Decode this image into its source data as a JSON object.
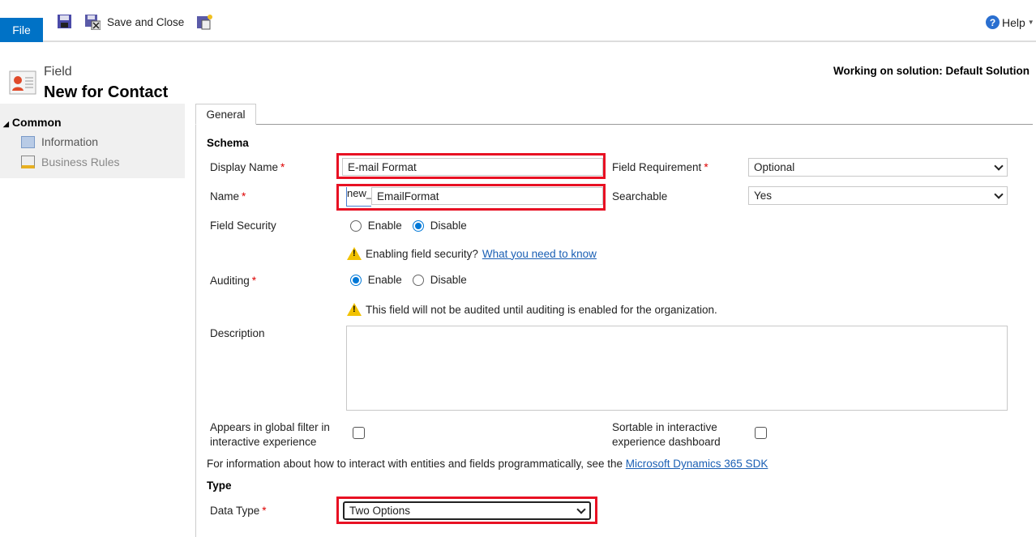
{
  "toolbar": {
    "file": "File",
    "save_close": "Save and Close",
    "help": "Help"
  },
  "header": {
    "entity": "Field",
    "title": "New for Contact",
    "solution": "Working on solution: Default Solution"
  },
  "nav": {
    "section": "Common",
    "items": [
      {
        "label": "Information"
      },
      {
        "label": "Business Rules"
      }
    ]
  },
  "tabs": [
    {
      "label": "General"
    }
  ],
  "schema": {
    "heading": "Schema",
    "display_name_label": "Display Name",
    "display_name_value": "E-mail Format",
    "name_label": "Name",
    "name_prefix": "new_",
    "name_value": "EmailFormat",
    "field_requirement_label": "Field Requirement",
    "field_requirement_value": "Optional",
    "searchable_label": "Searchable",
    "searchable_value": "Yes",
    "field_security_label": "Field Security",
    "enable": "Enable",
    "disable": "Disable",
    "field_security_selected": "Disable",
    "security_warning": "Enabling field security?",
    "security_link": "What you need to know",
    "auditing_label": "Auditing",
    "auditing_selected": "Enable",
    "audit_warning": "This field will not be audited until auditing is enabled for the organization.",
    "description_label": "Description",
    "description_value": "",
    "global_filter_label": "Appears in global filter in interactive experience",
    "global_filter_checked": false,
    "sortable_label": "Sortable in interactive experience dashboard",
    "sortable_checked": false,
    "info_text": "For information about how to interact with entities and fields programmatically, see the",
    "info_link": "Microsoft Dynamics 365 SDK"
  },
  "type": {
    "heading": "Type",
    "data_type_label": "Data Type",
    "data_type_value": "Two Options"
  },
  "colors": {
    "accent": "#0072c6",
    "highlight": "#e81123",
    "required": "#dd0000"
  }
}
